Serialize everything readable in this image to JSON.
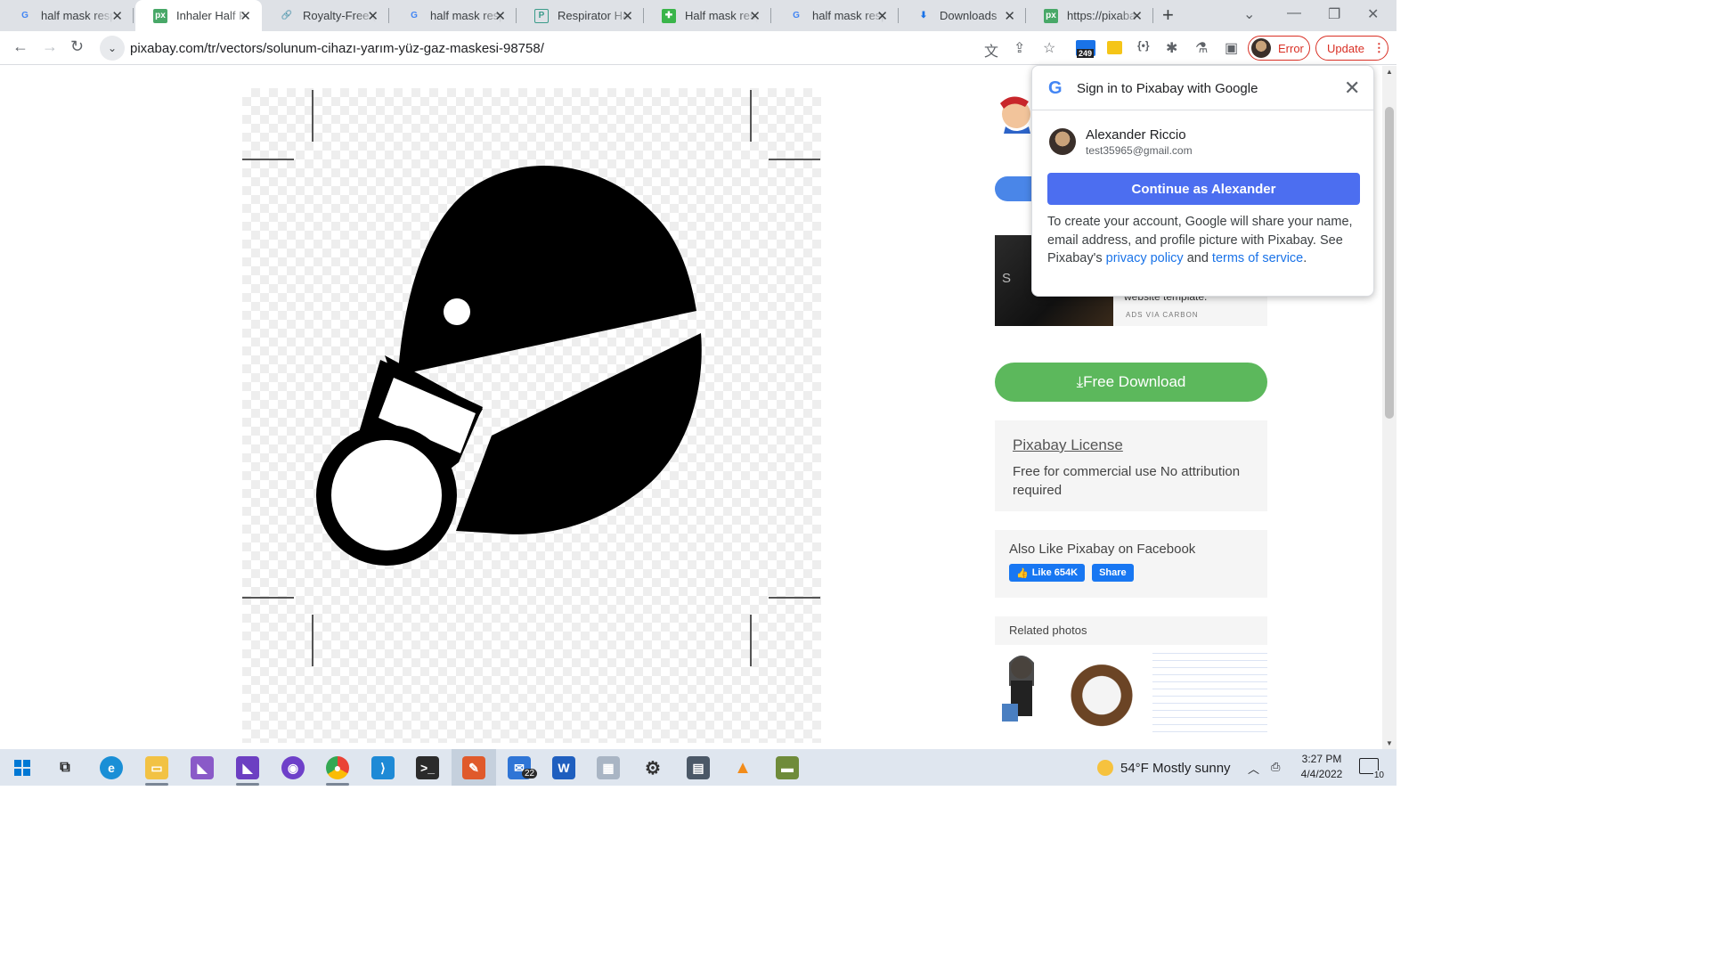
{
  "tabs": [
    {
      "title": "half mask resp",
      "favicon": "google-icon",
      "active": false
    },
    {
      "title": "Inhaler Half Fa",
      "favicon": "pixabay-icon",
      "active": true
    },
    {
      "title": "Royalty-Free (",
      "favicon": "link-icon",
      "active": false
    },
    {
      "title": "half mask resp",
      "favicon": "google-icon",
      "active": false
    },
    {
      "title": "Respirator Hal",
      "favicon": "p-icon",
      "active": false
    },
    {
      "title": "Half mask resp",
      "favicon": "green-icon",
      "active": false
    },
    {
      "title": "half mask resp",
      "favicon": "google-icon",
      "active": false
    },
    {
      "title": "Downloads",
      "favicon": "download-icon",
      "active": false
    },
    {
      "title": "https://pixaba",
      "favicon": "pixabay-icon",
      "active": false
    }
  ],
  "toolbar": {
    "url": "pixabay.com/tr/vectors/solunum-cihazı-yarım-yüz-gaz-maskesi-98758/",
    "extension_badge": "249",
    "profile_label": "Error",
    "update_label": "Update"
  },
  "popup": {
    "title": "Sign in to Pixabay with Google",
    "account_name": "Alexander Riccio",
    "account_email": "test35965@gmail.com",
    "continue_label": "Continue as Alexander",
    "desc_prefix": "To create your account, Google will share your name, email address, and profile picture with Pixabay. See Pixabay's ",
    "privacy_link": "privacy policy",
    "desc_and": " and ",
    "terms_link": "terms of service",
    "desc_end": "."
  },
  "sidebar": {
    "ad_text": "website template.",
    "ad_via": "ADS VIA CARBON",
    "ad_logo": "S",
    "download_label": "Free Download",
    "license_title": "Pixabay License",
    "license_text": "Free for commercial use No attribution required",
    "facebook_title": "Also Like Pixabay on Facebook",
    "fb_like": "Like 654K",
    "fb_share": "Share",
    "related_title": "Related photos"
  },
  "taskbar": {
    "mail_badge": "22",
    "weather": "54°F  Mostly sunny",
    "time": "3:27 PM",
    "date": "4/4/2022",
    "notifications": "10"
  },
  "colors": {
    "accent_blue": "#4c6ef0",
    "download_green": "#5cb85c",
    "error_red": "#d93025"
  }
}
